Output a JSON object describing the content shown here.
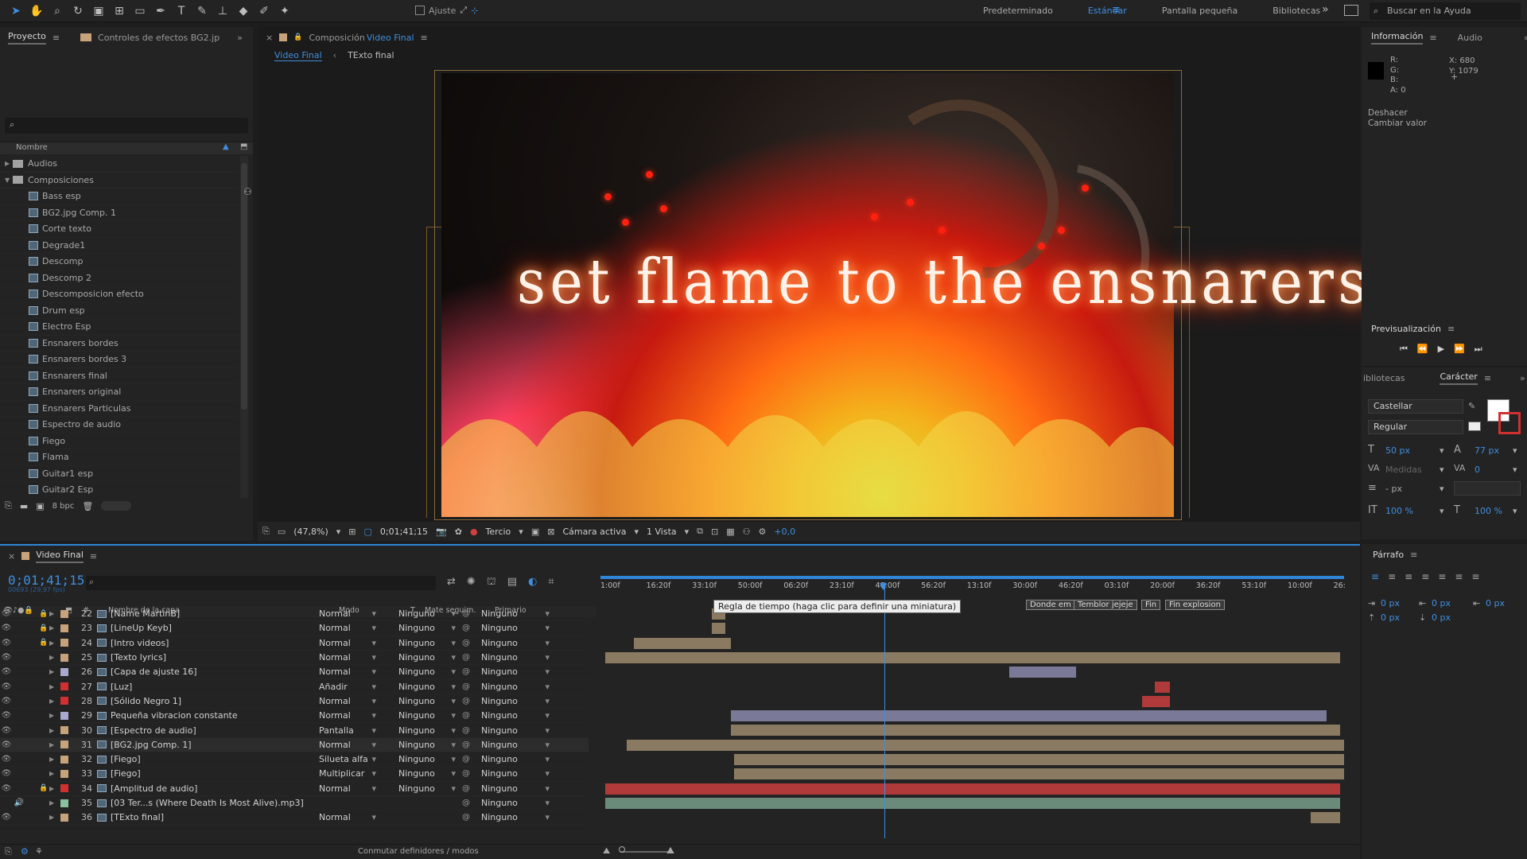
{
  "toolbar": {
    "snap_label": "Ajuste",
    "workspaces": [
      "Predeterminado",
      "Estándar",
      "Pantalla pequeña",
      "Bibliotecas"
    ],
    "help_placeholder": "Buscar en la Ayuda"
  },
  "project": {
    "tab_label": "Proyecto",
    "effects_tab_label": "Controles de efectos BG2.jp",
    "column_name": "Nombre",
    "folders": [
      {
        "label": "Audios",
        "expanded": false
      },
      {
        "label": "Composiciones",
        "expanded": true
      }
    ],
    "items": [
      "Bass esp",
      "BG2.jpg Comp. 1",
      "Corte texto",
      "Degrade1",
      "Descomp",
      "Descomp 2",
      "Descomposicion efecto",
      "Drum esp",
      "Electro Esp",
      "Ensnarers bordes",
      "Ensnarers bordes 3",
      "Ensnarers final",
      "Ensnarers original",
      "Ensnarers Particulas",
      "Espectro de audio",
      "Fiego",
      "Flama",
      "Guitar1 esp",
      "Guitar2 Esp"
    ],
    "bpc": "8 bpc"
  },
  "viewer": {
    "comp_prefix": "Composición",
    "comp_name": "Video Final",
    "tabs": [
      "Video Final",
      "TExto final"
    ],
    "flame_text": "set flame to the ensnarers",
    "zoom": "(47,8%)",
    "timecode": "0;01;41;15",
    "grid": "Tercio",
    "camera": "Cámara activa",
    "views": "1 Vista",
    "exposure": "+0,0"
  },
  "info": {
    "tab_label": "Información",
    "audio_tab_label": "Audio",
    "r": "R:",
    "g": "G:",
    "b": "B:",
    "a": "A:  0",
    "x": "X:  680",
    "y": "Y:  1079",
    "undo_label": "Deshacer",
    "undo_action": "Cambiar valor"
  },
  "preview": {
    "tab_label": "Previsualización"
  },
  "character": {
    "libraries_tab": "ibliotecas",
    "tab_label": "Carácter",
    "font": "Castellar",
    "style": "Regular",
    "size": "50 px",
    "leading": "77 px",
    "kerning": "Medidas",
    "tracking": "0",
    "stroke": "- px",
    "vscale": "100 %",
    "hscale": "100 %"
  },
  "timeline": {
    "tab_label": "Video Final",
    "timecode": "0;01;41;15",
    "sub_timecode": "00693 (29,97 fps)",
    "col_name": "Nombre de la capa",
    "col_mode": "Modo",
    "col_t": "T",
    "col_matte": "Mate seguim.",
    "col_parent": "Primario",
    "bottom_label": "Conmutar definidores / modos",
    "ruler_labels": [
      "1:00f",
      "16:20f",
      "33:10f",
      "50:00f",
      "06:20f",
      "23:10f",
      "40:00f",
      "56:20f",
      "13:10f",
      "30:00f",
      "46:20f",
      "03:10f",
      "20:00f",
      "36:20f",
      "53:10f",
      "10:00f",
      "26:"
    ],
    "tooltip": "Regla de tiempo (haga clic para definir una miniatura)",
    "markers": [
      "Donde em",
      "Temblor jejeje",
      "Fin",
      "Fin explosion"
    ],
    "layers": [
      {
        "num": "22",
        "name": "[Name MartinB]",
        "mode": "Normal",
        "matte": "Ninguno",
        "parent": "Ninguno",
        "label": "#c7a27a",
        "lock": true
      },
      {
        "num": "23",
        "name": "[LineUp Keyb]",
        "mode": "Normal",
        "matte": "Ninguno",
        "parent": "Ninguno",
        "label": "#c7a27a",
        "lock": true
      },
      {
        "num": "24",
        "name": "[Intro videos]",
        "mode": "Normal",
        "matte": "Ninguno",
        "parent": "Ninguno",
        "label": "#c7a27a",
        "lock": true
      },
      {
        "num": "25",
        "name": "[Texto lyrics]",
        "mode": "Normal",
        "matte": "Ninguno",
        "parent": "Ninguno",
        "label": "#c7a27a",
        "lock": false
      },
      {
        "num": "26",
        "name": "[Capa de ajuste 16]",
        "mode": "Normal",
        "matte": "Ninguno",
        "parent": "Ninguno",
        "label": "#a9a9cf",
        "lock": false
      },
      {
        "num": "27",
        "name": "[Luz]",
        "mode": "Añadir",
        "matte": "Ninguno",
        "parent": "Ninguno",
        "label": "#d03030",
        "lock": false
      },
      {
        "num": "28",
        "name": "[Sólido Negro 1]",
        "mode": "Normal",
        "matte": "Ninguno",
        "parent": "Ninguno",
        "label": "#d03030",
        "lock": false
      },
      {
        "num": "29",
        "name": "Pequeña vibracion constante",
        "mode": "Normal",
        "matte": "Ninguno",
        "parent": "Ninguno",
        "label": "#a9a9cf",
        "lock": false
      },
      {
        "num": "30",
        "name": "[Espectro de audio]",
        "mode": "Pantalla",
        "matte": "Ninguno",
        "parent": "Ninguno",
        "label": "#c7a27a",
        "lock": false
      },
      {
        "num": "31",
        "name": "[BG2.jpg Comp. 1]",
        "mode": "Normal",
        "matte": "Ninguno",
        "parent": "Ninguno",
        "label": "#c7a27a",
        "lock": false
      },
      {
        "num": "32",
        "name": "[Fiego]",
        "mode": "Silueta alfa",
        "matte": "Ninguno",
        "parent": "Ninguno",
        "label": "#c7a27a",
        "lock": false
      },
      {
        "num": "33",
        "name": "[Fiego]",
        "mode": "Multiplicar",
        "matte": "Ninguno",
        "parent": "Ninguno",
        "label": "#c7a27a",
        "lock": false
      },
      {
        "num": "34",
        "name": "[Amplitud de audio]",
        "mode": "Normal",
        "matte": "Ninguno",
        "parent": "Ninguno",
        "label": "#d03030",
        "lock": true
      },
      {
        "num": "35",
        "name": "[03 Ter...s (Where Death Is Most Alive).mp3]",
        "mode": "",
        "matte": "",
        "parent": "Ninguno",
        "label": "#8ac0a0",
        "lock": false
      },
      {
        "num": "36",
        "name": "[TExto final]",
        "mode": "Normal",
        "matte": "",
        "parent": "Ninguno",
        "label": "#c7a27a",
        "lock": false
      }
    ]
  },
  "paragraph": {
    "tab_label": "Párrafo",
    "indent_left": "0 px",
    "indent_first": "0 px",
    "indent_right": "0 px",
    "space_before": "0 px",
    "space_after": "0 px"
  },
  "colors": {
    "accent": "#3f8fe0",
    "bar_tan": "#8a7a62",
    "bar_purple": "#7a7a98",
    "bar_red": "#b03a3a",
    "bar_green": "#6a8a7a"
  }
}
